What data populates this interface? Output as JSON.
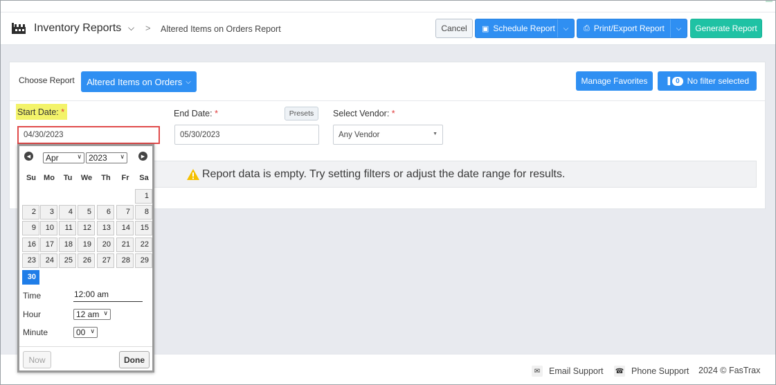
{
  "header": {
    "title": "Inventory Reports",
    "breadcrumb_sep": ">",
    "breadcrumb": "Altered Items on Orders Report",
    "cancel_label": "Cancel",
    "schedule_label": "Schedule Report",
    "print_label": "Print/Export Report",
    "generate_label": "Generate Report",
    "teal_color": "#1fc2a4",
    "blue_color": "#2f8ff2"
  },
  "toolbar": {
    "choose_label": "Choose Report",
    "report_value": "Altered Items on Orders",
    "favorites_label": "Manage Favorites",
    "filter_count": "0",
    "filter_label": "No filter selected"
  },
  "filters": {
    "start_label": "Start Date:",
    "start_value": "04/30/2023",
    "end_label": "End Date:",
    "end_value": "05/30/2023",
    "presets_label": "Presets",
    "vendor_label": "Select Vendor:",
    "vendor_value": "Any Vendor",
    "required_mark": "*"
  },
  "alert": {
    "message": "Report data is empty. Try setting filters or adjust the date range for results."
  },
  "datepicker": {
    "month": "Apr",
    "year": "2023",
    "weekdays": [
      "Su",
      "Mo",
      "Tu",
      "We",
      "Th",
      "Fr",
      "Sa"
    ],
    "days": [
      "1",
      "2",
      "3",
      "4",
      "5",
      "6",
      "7",
      "8",
      "9",
      "10",
      "11",
      "12",
      "13",
      "14",
      "15",
      "16",
      "17",
      "18",
      "19",
      "20",
      "21",
      "22",
      "23",
      "24",
      "25",
      "26",
      "27",
      "28",
      "29",
      "30"
    ],
    "first_weekday": 6,
    "selected_day": "30",
    "time_label": "Time",
    "time_value": "12:00 am",
    "hour_label": "Hour",
    "hour_value": "12 am",
    "minute_label": "Minute",
    "minute_value": "00",
    "now_label": "Now",
    "done_label": "Done"
  },
  "footer": {
    "email_label": "Email Support",
    "phone_label": "Phone Support",
    "copyright": "2024 © FasTrax"
  }
}
